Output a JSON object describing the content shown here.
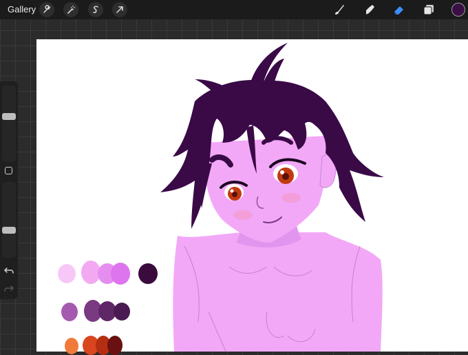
{
  "topbar": {
    "gallery_label": "Gallery",
    "left_tools": [
      "wrench-icon",
      "magic-wand-icon",
      "selection-icon",
      "transform-arrow-icon"
    ],
    "right_tools": [
      "brush-icon",
      "smudge-icon",
      "eraser-icon",
      "layers-icon"
    ],
    "active_tool": "eraser-icon",
    "active_color": "#3a0f45"
  },
  "sidebar": {
    "size_slider_level": 0.6,
    "opacity_slider_level": 0.35,
    "buttons": [
      "modify-square-icon",
      "undo-icon",
      "redo-icon"
    ]
  },
  "palette": {
    "row1": [
      "#f7c8f7",
      "#f3a9f2",
      "#e68ef0",
      "#dd75ee",
      "#3a0b3c"
    ],
    "row2": [
      "#a55ab0",
      "#7a3a82",
      "#5f2766",
      "#4a1a52"
    ],
    "row3": [
      "#f07a3a",
      "#d9451f",
      "#b52e12",
      "#6a1010"
    ]
  },
  "colors": {
    "hair": "#3a0a47",
    "skin": "#f2a8f7",
    "eye": "#c23a12"
  }
}
